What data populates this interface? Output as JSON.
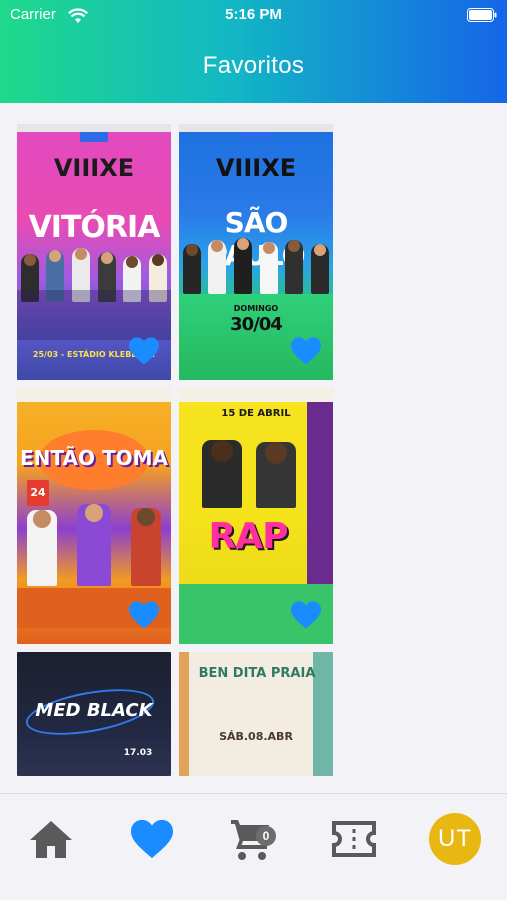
{
  "status_bar": {
    "carrier": "Carrier",
    "time": "5:16 PM"
  },
  "header": {
    "title": "Favoritos"
  },
  "favorites": [
    {
      "poster_logo": "VIIIXE",
      "poster_headline": "VITÓRIA",
      "poster_date_line": "25/03 - ESTÁDIO KLEBER A.",
      "liked": true
    },
    {
      "poster_logo": "VIIIXE",
      "poster_headline": "SÃO PAULO",
      "poster_date_line": "30/04",
      "poster_sub": "DOMINGO",
      "liked": true
    },
    {
      "poster_logo": "ENTÃO TOMA",
      "poster_headline": "",
      "poster_date_line": "24",
      "liked": true
    },
    {
      "poster_logo": "15 DE ABRIL",
      "poster_headline": "RAP",
      "poster_date_line": "",
      "liked": true
    },
    {
      "poster_logo": "MED BLACK",
      "poster_headline": "",
      "poster_date_line": "17.03",
      "liked": false
    },
    {
      "poster_logo": "BEN DITA PRAIA",
      "poster_headline": "",
      "poster_date_line": "SÁB.08.ABR",
      "liked": false
    }
  ],
  "tabbar": {
    "items": [
      {
        "name": "home",
        "icon": "home-icon"
      },
      {
        "name": "favorites",
        "icon": "heart-icon",
        "active": true
      },
      {
        "name": "cart",
        "icon": "cart-icon",
        "badge": "0"
      },
      {
        "name": "tickets",
        "icon": "ticket-icon"
      },
      {
        "name": "profile",
        "initials": "UT"
      }
    ]
  },
  "colors": {
    "accent": "#1a8cff",
    "header_start": "#1fd98a",
    "header_end": "#1565e8",
    "avatar": "#e8b711",
    "tab_icon": "#5a5a5a"
  }
}
